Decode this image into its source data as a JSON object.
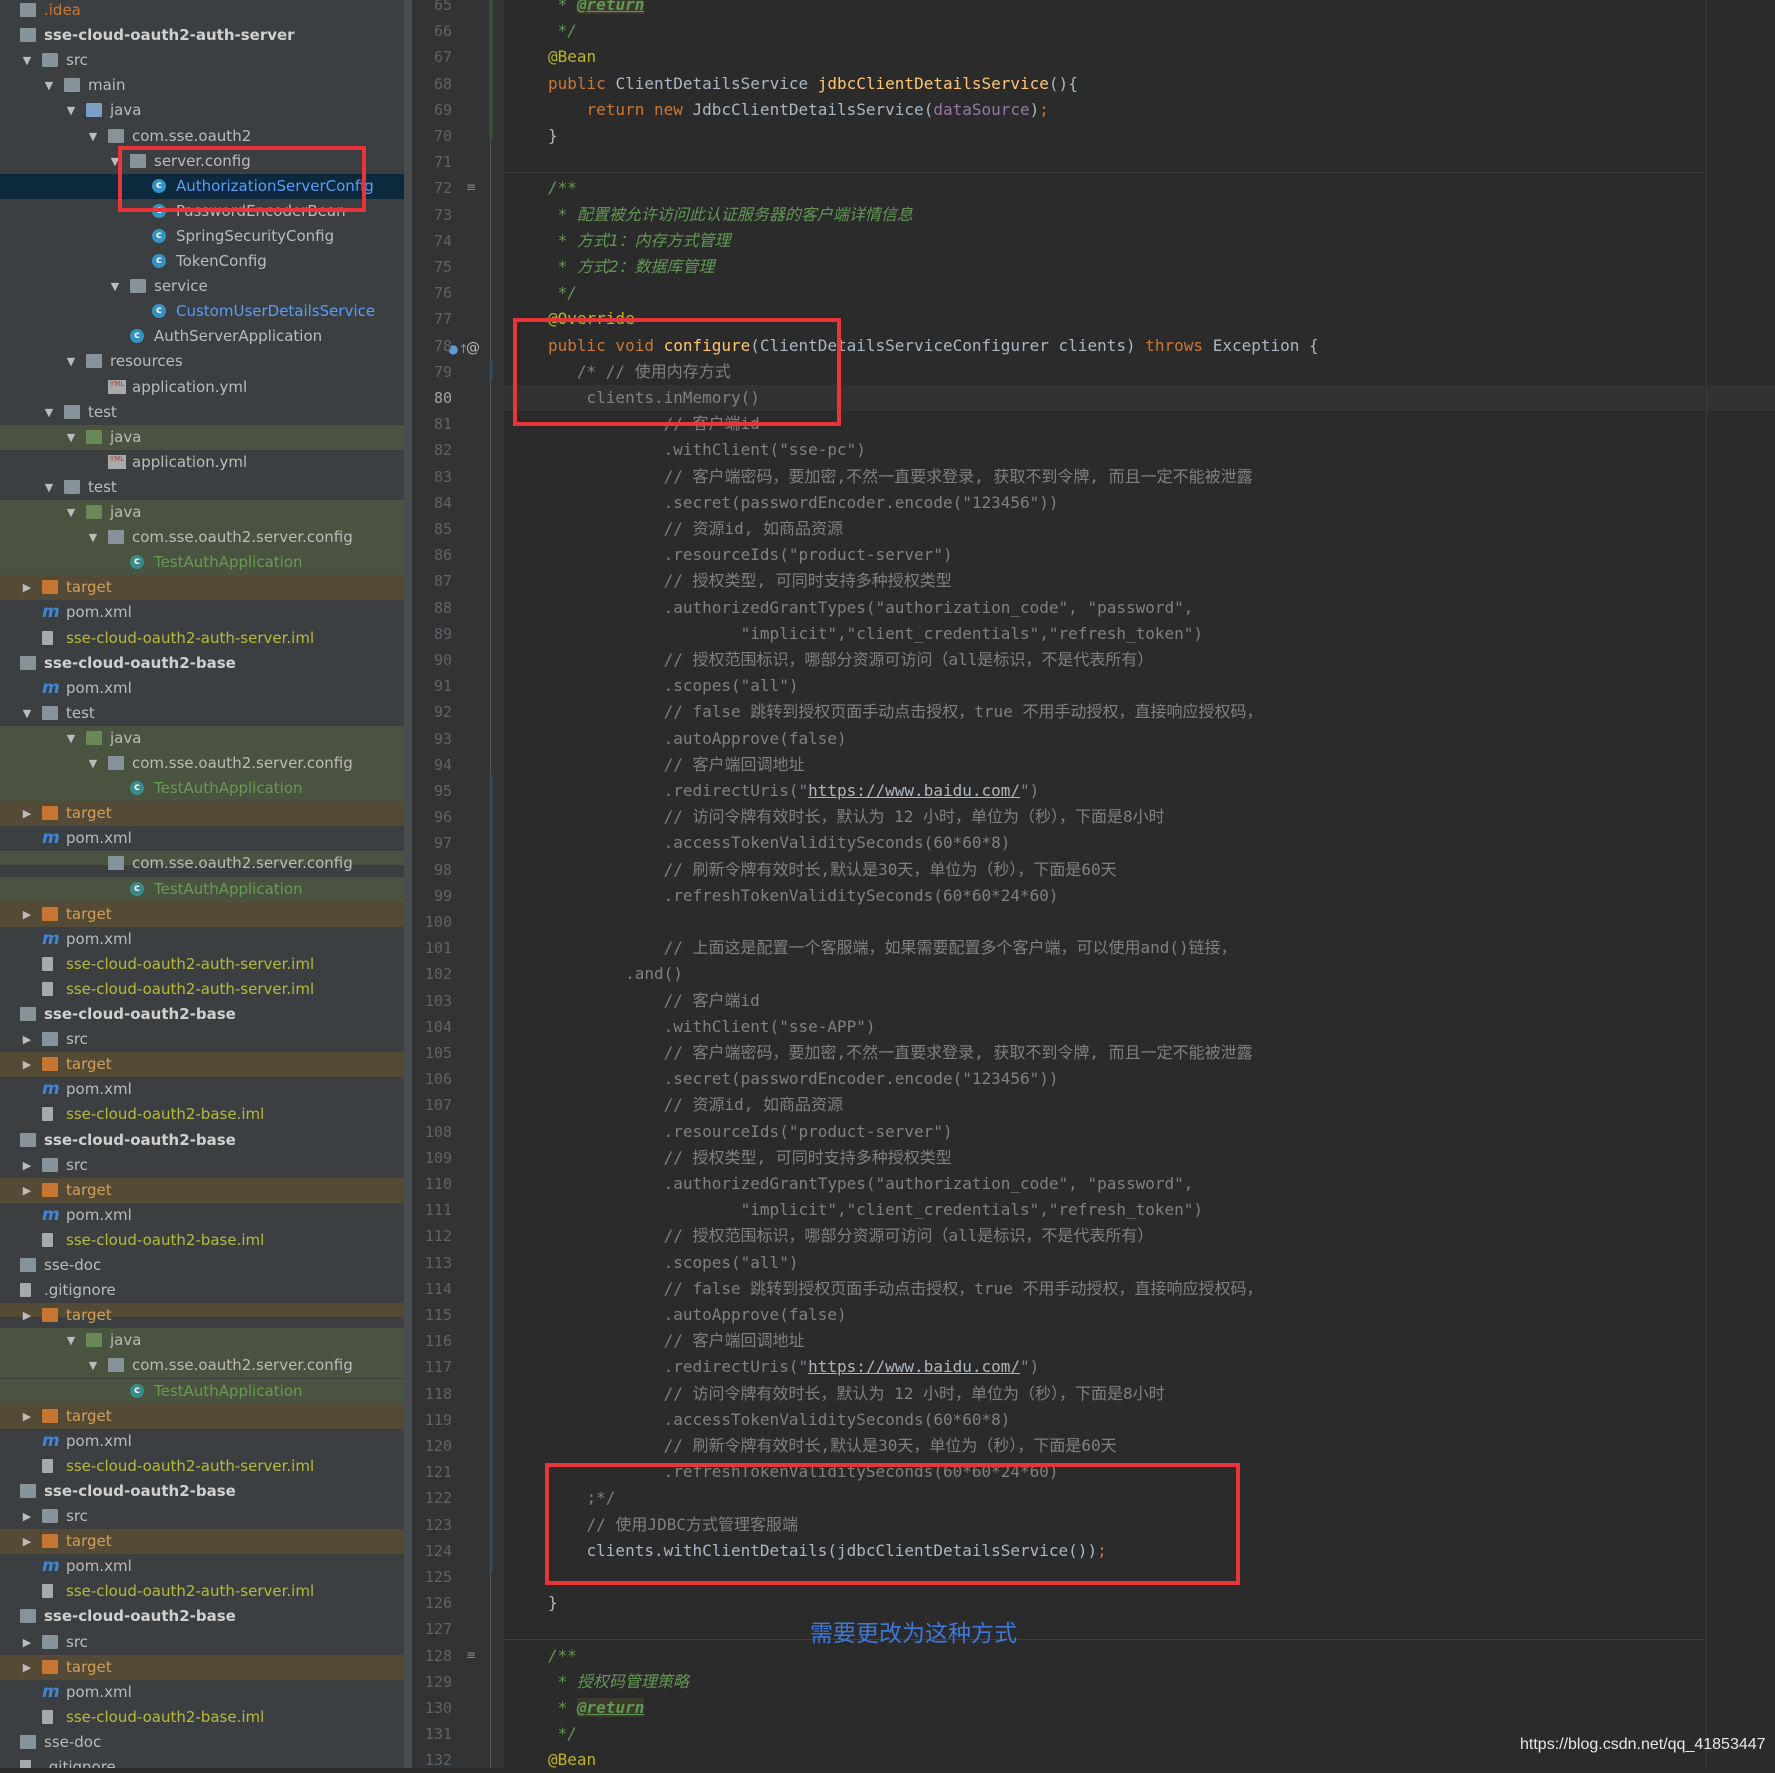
{
  "tree": [
    {
      "label": ".idea",
      "depth": 0,
      "arrow": "",
      "icon": "folder",
      "color": "orange"
    },
    {
      "label": "sse-cloud-oauth2-auth-server",
      "depth": 0,
      "arrow": "",
      "icon": "module",
      "bold": true
    },
    {
      "label": "src",
      "depth": 1,
      "arrow": "▼",
      "icon": "folder"
    },
    {
      "label": "main",
      "depth": 2,
      "arrow": "▼",
      "icon": "folder"
    },
    {
      "label": "java",
      "depth": 3,
      "arrow": "▼",
      "icon": "folder-blue"
    },
    {
      "label": "com.sse.oauth2",
      "depth": 4,
      "arrow": "▼",
      "icon": "package"
    },
    {
      "label": "server.config",
      "depth": 5,
      "arrow": "▼",
      "icon": "package"
    },
    {
      "label": "AuthorizationServerConfig",
      "depth": 6,
      "icon": "class",
      "color": "blue",
      "selected": true
    },
    {
      "label": "PasswordEncoderBean",
      "depth": 6,
      "icon": "class"
    },
    {
      "label": "SpringSecurityConfig",
      "depth": 6,
      "icon": "class"
    },
    {
      "label": "TokenConfig",
      "depth": 6,
      "icon": "class"
    },
    {
      "label": "service",
      "depth": 5,
      "arrow": "▼",
      "icon": "package"
    },
    {
      "label": "CustomUserDetailsService",
      "depth": 6,
      "icon": "class",
      "color": "blue"
    },
    {
      "label": "AuthServerApplication",
      "depth": 5,
      "icon": "class"
    },
    {
      "label": "resources",
      "depth": 3,
      "arrow": "▼",
      "icon": "folder"
    },
    {
      "label": "application.yml",
      "depth": 4,
      "icon": "yml"
    },
    {
      "label": "test",
      "depth": 2,
      "arrow": "▼",
      "icon": "folder"
    },
    {
      "label": "java",
      "depth": 3,
      "arrow": "▼",
      "icon": "folder-green",
      "bg": "test"
    },
    {
      "label": "application.yml",
      "depth": 4,
      "icon": "yml"
    },
    {
      "label": "test",
      "depth": 2,
      "arrow": "▼",
      "icon": "folder"
    },
    {
      "label": "java",
      "depth": 3,
      "arrow": "▼",
      "icon": "folder-green",
      "bg": "test"
    },
    {
      "label": "com.sse.oauth2.server.config",
      "depth": 4,
      "arrow": "▼",
      "icon": "package",
      "bg": "test"
    },
    {
      "label": "TestAuthApplication",
      "depth": 5,
      "icon": "class-test",
      "color": "green",
      "bg": "test"
    },
    {
      "label": "target",
      "depth": 1,
      "arrow": "▶",
      "icon": "folder-orange",
      "color": "target",
      "bg": "target"
    },
    {
      "label": "pom.xml",
      "depth": 1,
      "icon": "maven"
    },
    {
      "label": "sse-cloud-oauth2-auth-server.iml",
      "depth": 1,
      "icon": "iml",
      "color": "iml"
    },
    {
      "label": "sse-cloud-oauth2-base",
      "depth": 0,
      "icon": "module",
      "bold": true,
      "clip": true
    },
    {
      "label": "pom.xml",
      "depth": 1,
      "icon": "maven"
    },
    {
      "label": "test",
      "depth": 1,
      "arrow": "▼",
      "icon": "folder"
    },
    {
      "label": "java",
      "depth": 3,
      "arrow": "▼",
      "icon": "folder-green",
      "bg": "test"
    },
    {
      "label": "com.sse.oauth2.server.config",
      "depth": 4,
      "arrow": "▼",
      "icon": "package",
      "bg": "test"
    },
    {
      "label": "TestAuthApplication",
      "depth": 5,
      "icon": "class-test",
      "color": "green",
      "bg": "test"
    },
    {
      "label": "target",
      "depth": 1,
      "arrow": "▶",
      "icon": "folder-orange",
      "color": "target",
      "bg": "target"
    },
    {
      "label": "pom.xml",
      "depth": 1,
      "icon": "maven"
    },
    {
      "label": "com.sse.oauth2.server.config",
      "depth": 4,
      "icon": "package",
      "bg": "test",
      "clip": true
    },
    {
      "label": "TestAuthApplication",
      "depth": 5,
      "icon": "class-test",
      "color": "green",
      "bg": "test"
    },
    {
      "label": "target",
      "depth": 1,
      "arrow": "▶",
      "icon": "folder-orange",
      "color": "target",
      "bg": "target"
    },
    {
      "label": "pom.xml",
      "depth": 1,
      "icon": "maven"
    },
    {
      "label": "sse-cloud-oauth2-auth-server.iml",
      "depth": 1,
      "icon": "iml",
      "color": "iml"
    },
    {
      "label": "sse-cloud-oauth2-auth-server.iml",
      "depth": 1,
      "icon": "iml",
      "color": "iml"
    },
    {
      "label": "sse-cloud-oauth2-base",
      "depth": 0,
      "icon": "module",
      "bold": true
    },
    {
      "label": "src",
      "depth": 1,
      "arrow": "▶",
      "icon": "folder"
    },
    {
      "label": "target",
      "depth": 1,
      "arrow": "▶",
      "icon": "folder-orange",
      "color": "target",
      "bg": "target"
    },
    {
      "label": "pom.xml",
      "depth": 1,
      "icon": "maven"
    },
    {
      "label": "sse-cloud-oauth2-base.iml",
      "depth": 1,
      "icon": "iml",
      "color": "iml"
    },
    {
      "label": "sse-cloud-oauth2-base",
      "depth": 0,
      "icon": "module",
      "bold": true,
      "clip": true
    },
    {
      "label": "src",
      "depth": 1,
      "arrow": "▶",
      "icon": "folder"
    },
    {
      "label": "target",
      "depth": 1,
      "arrow": "▶",
      "icon": "folder-orange",
      "color": "target",
      "bg": "target"
    },
    {
      "label": "pom.xml",
      "depth": 1,
      "icon": "maven"
    },
    {
      "label": "sse-cloud-oauth2-base.iml",
      "depth": 1,
      "icon": "iml",
      "color": "iml"
    },
    {
      "label": "sse-doc",
      "depth": 0,
      "icon": "folder"
    },
    {
      "label": ".gitignore",
      "depth": 0,
      "icon": "iml"
    },
    {
      "label": "target",
      "depth": 1,
      "arrow": "▶",
      "icon": "folder-orange",
      "color": "target",
      "bg": "target",
      "clip": true
    },
    {
      "label": "java",
      "depth": 3,
      "arrow": "▼",
      "icon": "folder-green",
      "bg": "test"
    },
    {
      "label": "com.sse.oauth2.server.config",
      "depth": 4,
      "arrow": "▼",
      "icon": "package",
      "bg": "test"
    },
    {
      "label": "TestAuthApplication",
      "depth": 5,
      "icon": "class-test",
      "color": "green",
      "bg": "test"
    },
    {
      "label": "target",
      "depth": 1,
      "arrow": "▶",
      "icon": "folder-orange",
      "color": "target",
      "bg": "target"
    },
    {
      "label": "pom.xml",
      "depth": 1,
      "icon": "maven"
    },
    {
      "label": "sse-cloud-oauth2-auth-server.iml",
      "depth": 1,
      "icon": "iml",
      "color": "iml"
    },
    {
      "label": "sse-cloud-oauth2-base",
      "depth": 0,
      "icon": "module",
      "bold": true
    },
    {
      "label": "src",
      "depth": 1,
      "arrow": "▶",
      "icon": "folder"
    },
    {
      "label": "target",
      "depth": 1,
      "arrow": "▶",
      "icon": "folder-orange",
      "color": "target",
      "bg": "target"
    },
    {
      "label": "pom.xml",
      "depth": 1,
      "icon": "maven"
    },
    {
      "label": "sse-cloud-oauth2-auth-server.iml",
      "depth": 1,
      "icon": "iml",
      "color": "iml"
    },
    {
      "label": "sse-cloud-oauth2-base",
      "depth": 0,
      "icon": "module",
      "bold": true
    },
    {
      "label": "src",
      "depth": 1,
      "arrow": "▶",
      "icon": "folder"
    },
    {
      "label": "target",
      "depth": 1,
      "arrow": "▶",
      "icon": "folder-orange",
      "color": "target",
      "bg": "target"
    },
    {
      "label": "pom.xml",
      "depth": 1,
      "icon": "maven"
    },
    {
      "label": "sse-cloud-oauth2-base.iml",
      "depth": 1,
      "icon": "iml",
      "color": "iml"
    },
    {
      "label": "sse-doc",
      "depth": 0,
      "icon": "folder"
    },
    {
      "label": ".gitignore",
      "depth": 0,
      "icon": "iml",
      "overlay": "sse-doc"
    },
    {
      "label": ".gitignore",
      "depth": 0,
      "icon": "iml"
    }
  ],
  "editor": {
    "first_line_number": 65,
    "current_line": 80,
    "lines": [
      [
        [
          "doc",
          " * "
        ],
        [
          "tag",
          "@return"
        ]
      ],
      [
        [
          "doc",
          " */"
        ]
      ],
      [
        [
          "an",
          "@Bean"
        ]
      ],
      [
        [
          "kw",
          "public "
        ],
        [
          "t",
          "ClientDetailsService "
        ],
        [
          "fn",
          "jdbcClientDetailsService"
        ],
        [
          "t",
          "(){"
        ]
      ],
      [
        [
          "t",
          "    "
        ],
        [
          "kw",
          "return new "
        ],
        [
          "t",
          "JdbcClientDetailsService("
        ],
        [
          "fld",
          "dataSource"
        ],
        [
          "t",
          ")"
        ],
        [
          "kw",
          ";"
        ]
      ],
      [
        [
          "t",
          "}"
        ]
      ],
      [
        [
          "t",
          ""
        ]
      ],
      [
        [
          "doc",
          "/**"
        ]
      ],
      [
        [
          "doc",
          " * 配置被允许访问此认证服务器的客户端详情信息"
        ]
      ],
      [
        [
          "doc",
          " * 方式1：内存方式管理"
        ]
      ],
      [
        [
          "doc",
          " * 方式2：数据库管理"
        ]
      ],
      [
        [
          "doc",
          " */"
        ]
      ],
      [
        [
          "an",
          "@Override"
        ]
      ],
      [
        [
          "kw",
          "public void "
        ],
        [
          "fn",
          "configure"
        ],
        [
          "t",
          "(ClientDetailsServiceConfigurer clients) "
        ],
        [
          "kw",
          "throws "
        ],
        [
          "t",
          "Exception {"
        ]
      ],
      [
        [
          "cm",
          "   /* // 使用内存方式"
        ]
      ],
      [
        [
          "cm",
          "    clients.inMemory()"
        ]
      ],
      [
        [
          "cm",
          "            // 客户端id"
        ]
      ],
      [
        [
          "cm",
          "            .withClient(\"sse-pc\")"
        ]
      ],
      [
        [
          "cm",
          "            // 客户端密码，要加密,不然一直要求登录, 获取不到令牌, 而且一定不能被泄露"
        ]
      ],
      [
        [
          "cm",
          "            .secret(passwordEncoder.encode(\"123456\"))"
        ]
      ],
      [
        [
          "cm",
          "            // 资源id, 如商品资源"
        ]
      ],
      [
        [
          "cm",
          "            .resourceIds(\"product-server\")"
        ]
      ],
      [
        [
          "cm",
          "            // 授权类型, 可同时支持多种授权类型"
        ]
      ],
      [
        [
          "cm",
          "            .authorizedGrantTypes(\"authorization_code\", \"password\","
        ]
      ],
      [
        [
          "cm",
          "                    \"implicit\",\"client_credentials\",\"refresh_token\")"
        ]
      ],
      [
        [
          "cm",
          "            // 授权范围标识，哪部分资源可访问（all是标识，不是代表所有）"
        ]
      ],
      [
        [
          "cm",
          "            .scopes(\"all\")"
        ]
      ],
      [
        [
          "cm",
          "            // false 跳转到授权页面手动点击授权，true 不用手动授权，直接响应授权码，"
        ]
      ],
      [
        [
          "cm",
          "            .autoApprove(false)"
        ]
      ],
      [
        [
          "cm",
          "            // 客户端回调地址"
        ]
      ],
      [
        [
          "cm",
          "            .redirectUris(\""
        ],
        [
          "url",
          "https://www.baidu.com/"
        ],
        [
          "cm",
          "\")"
        ]
      ],
      [
        [
          "cm",
          "            // 访问令牌有效时长，默认为 12 小时，单位为（秒），下面是8小时"
        ]
      ],
      [
        [
          "cm",
          "            .accessTokenValiditySeconds(60*60*8)"
        ]
      ],
      [
        [
          "cm",
          "            // 刷新令牌有效时长,默认是30天，单位为（秒），下面是60天"
        ]
      ],
      [
        [
          "cm",
          "            .refreshTokenValiditySeconds(60*60*24*60)"
        ]
      ],
      [
        [
          "t",
          ""
        ]
      ],
      [
        [
          "cm",
          "            // 上面这是配置一个客服端，如果需要配置多个客户端，可以使用and()链接，"
        ]
      ],
      [
        [
          "cm",
          "        .and()"
        ]
      ],
      [
        [
          "cm",
          "            // 客户端id"
        ]
      ],
      [
        [
          "cm",
          "            .withClient(\"sse-APP\")"
        ]
      ],
      [
        [
          "cm",
          "            // 客户端密码，要加密,不然一直要求登录, 获取不到令牌, 而且一定不能被泄露"
        ]
      ],
      [
        [
          "cm",
          "            .secret(passwordEncoder.encode(\"123456\"))"
        ]
      ],
      [
        [
          "cm",
          "            // 资源id, 如商品资源"
        ]
      ],
      [
        [
          "cm",
          "            .resourceIds(\"product-server\")"
        ]
      ],
      [
        [
          "cm",
          "            // 授权类型, 可同时支持多种授权类型"
        ]
      ],
      [
        [
          "cm",
          "            .authorizedGrantTypes(\"authorization_code\", \"password\","
        ]
      ],
      [
        [
          "cm",
          "                    \"implicit\",\"client_credentials\",\"refresh_token\")"
        ]
      ],
      [
        [
          "cm",
          "            // 授权范围标识，哪部分资源可访问（all是标识，不是代表所有）"
        ]
      ],
      [
        [
          "cm",
          "            .scopes(\"all\")"
        ]
      ],
      [
        [
          "cm",
          "            // false 跳转到授权页面手动点击授权，true 不用手动授权，直接响应授权码，"
        ]
      ],
      [
        [
          "cm",
          "            .autoApprove(false)"
        ]
      ],
      [
        [
          "cm",
          "            // 客户端回调地址"
        ]
      ],
      [
        [
          "cm",
          "            .redirectUris(\""
        ],
        [
          "url",
          "https://www.baidu.com/"
        ],
        [
          "cm",
          "\")"
        ]
      ],
      [
        [
          "cm",
          "            // 访问令牌有效时长，默认为 12 小时，单位为（秒），下面是8小时"
        ]
      ],
      [
        [
          "cm",
          "            .accessTokenValiditySeconds(60*60*8)"
        ]
      ],
      [
        [
          "cm",
          "            // 刷新令牌有效时长,默认是30天，单位为（秒），下面是60天"
        ]
      ],
      [
        [
          "cm",
          "            .refreshTokenValiditySeconds(60*60*24*60)"
        ]
      ],
      [
        [
          "cm",
          "    ;*/"
        ]
      ],
      [
        [
          "cm",
          "    // 使用JDBC方式管理客服端"
        ]
      ],
      [
        [
          "t",
          "    clients.withClientDetails(jdbcClientDetailsService())"
        ],
        [
          "kw",
          ";"
        ]
      ],
      [
        [
          "t",
          ""
        ]
      ],
      [
        [
          "t",
          "}"
        ]
      ],
      [
        [
          "t",
          ""
        ]
      ],
      [
        [
          "doc",
          "/**"
        ]
      ],
      [
        [
          "doc",
          " * 授权码管理策略"
        ]
      ],
      [
        [
          "doc",
          " * "
        ],
        [
          "tag",
          "@return"
        ]
      ],
      [
        [
          "doc",
          " */"
        ]
      ],
      [
        [
          "an",
          "@Bean"
        ]
      ]
    ]
  },
  "annotation": {
    "caption": "需要更改为这种方式"
  },
  "watermark": "https://blog.csdn.net/qq_41853447",
  "colors": {
    "highlight_box": "#e8353b",
    "caption": "#3e78d8",
    "background": "#2b2b2b",
    "sidebar": "#3c3f41"
  }
}
